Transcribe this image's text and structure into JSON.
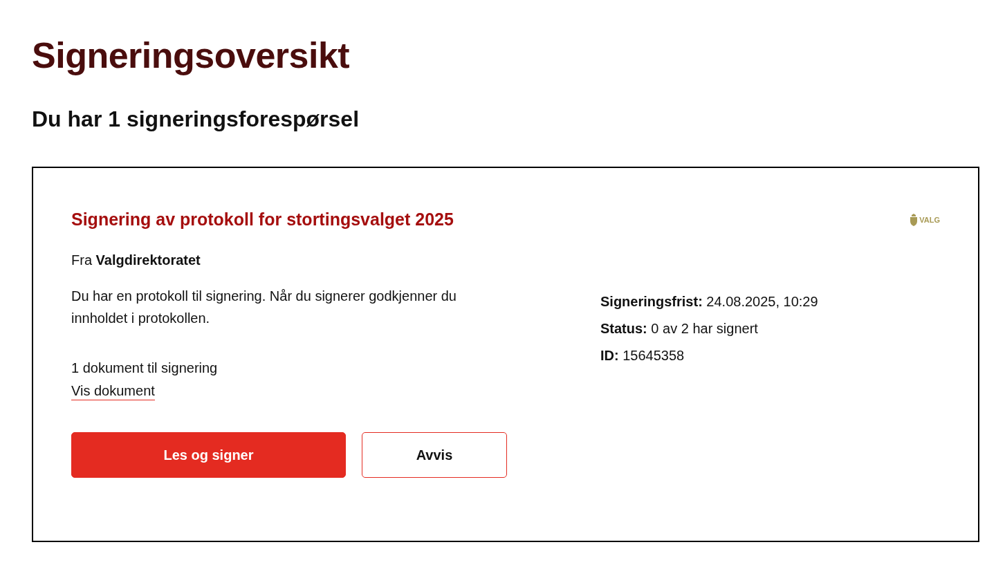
{
  "page_title": "Signeringsoversikt",
  "subtitle": "Du har 1 signeringsforespørsel",
  "request": {
    "title": "Signering av protokoll for stortingsvalget 2025",
    "logo_text": "VALG",
    "sender": "Fra **Valgdirektoratet**",
    "description": "Du har en protokoll til signering. Når du signerer godkjenner du innholdet i protokollen.",
    "document_count": "1 dokument til signering",
    "document_link": "Vis dokument",
    "details": [
      "**Signeringsfrist:** 24.08.2025, 10:29",
      "**Status:** 0 av 2 har signert",
      "**ID:** 15645358"
    ],
    "buttons": [
      {
        "label": "Les og signer",
        "kind": "primary"
      },
      {
        "label": "Avvis",
        "kind": "secondary"
      }
    ]
  }
}
